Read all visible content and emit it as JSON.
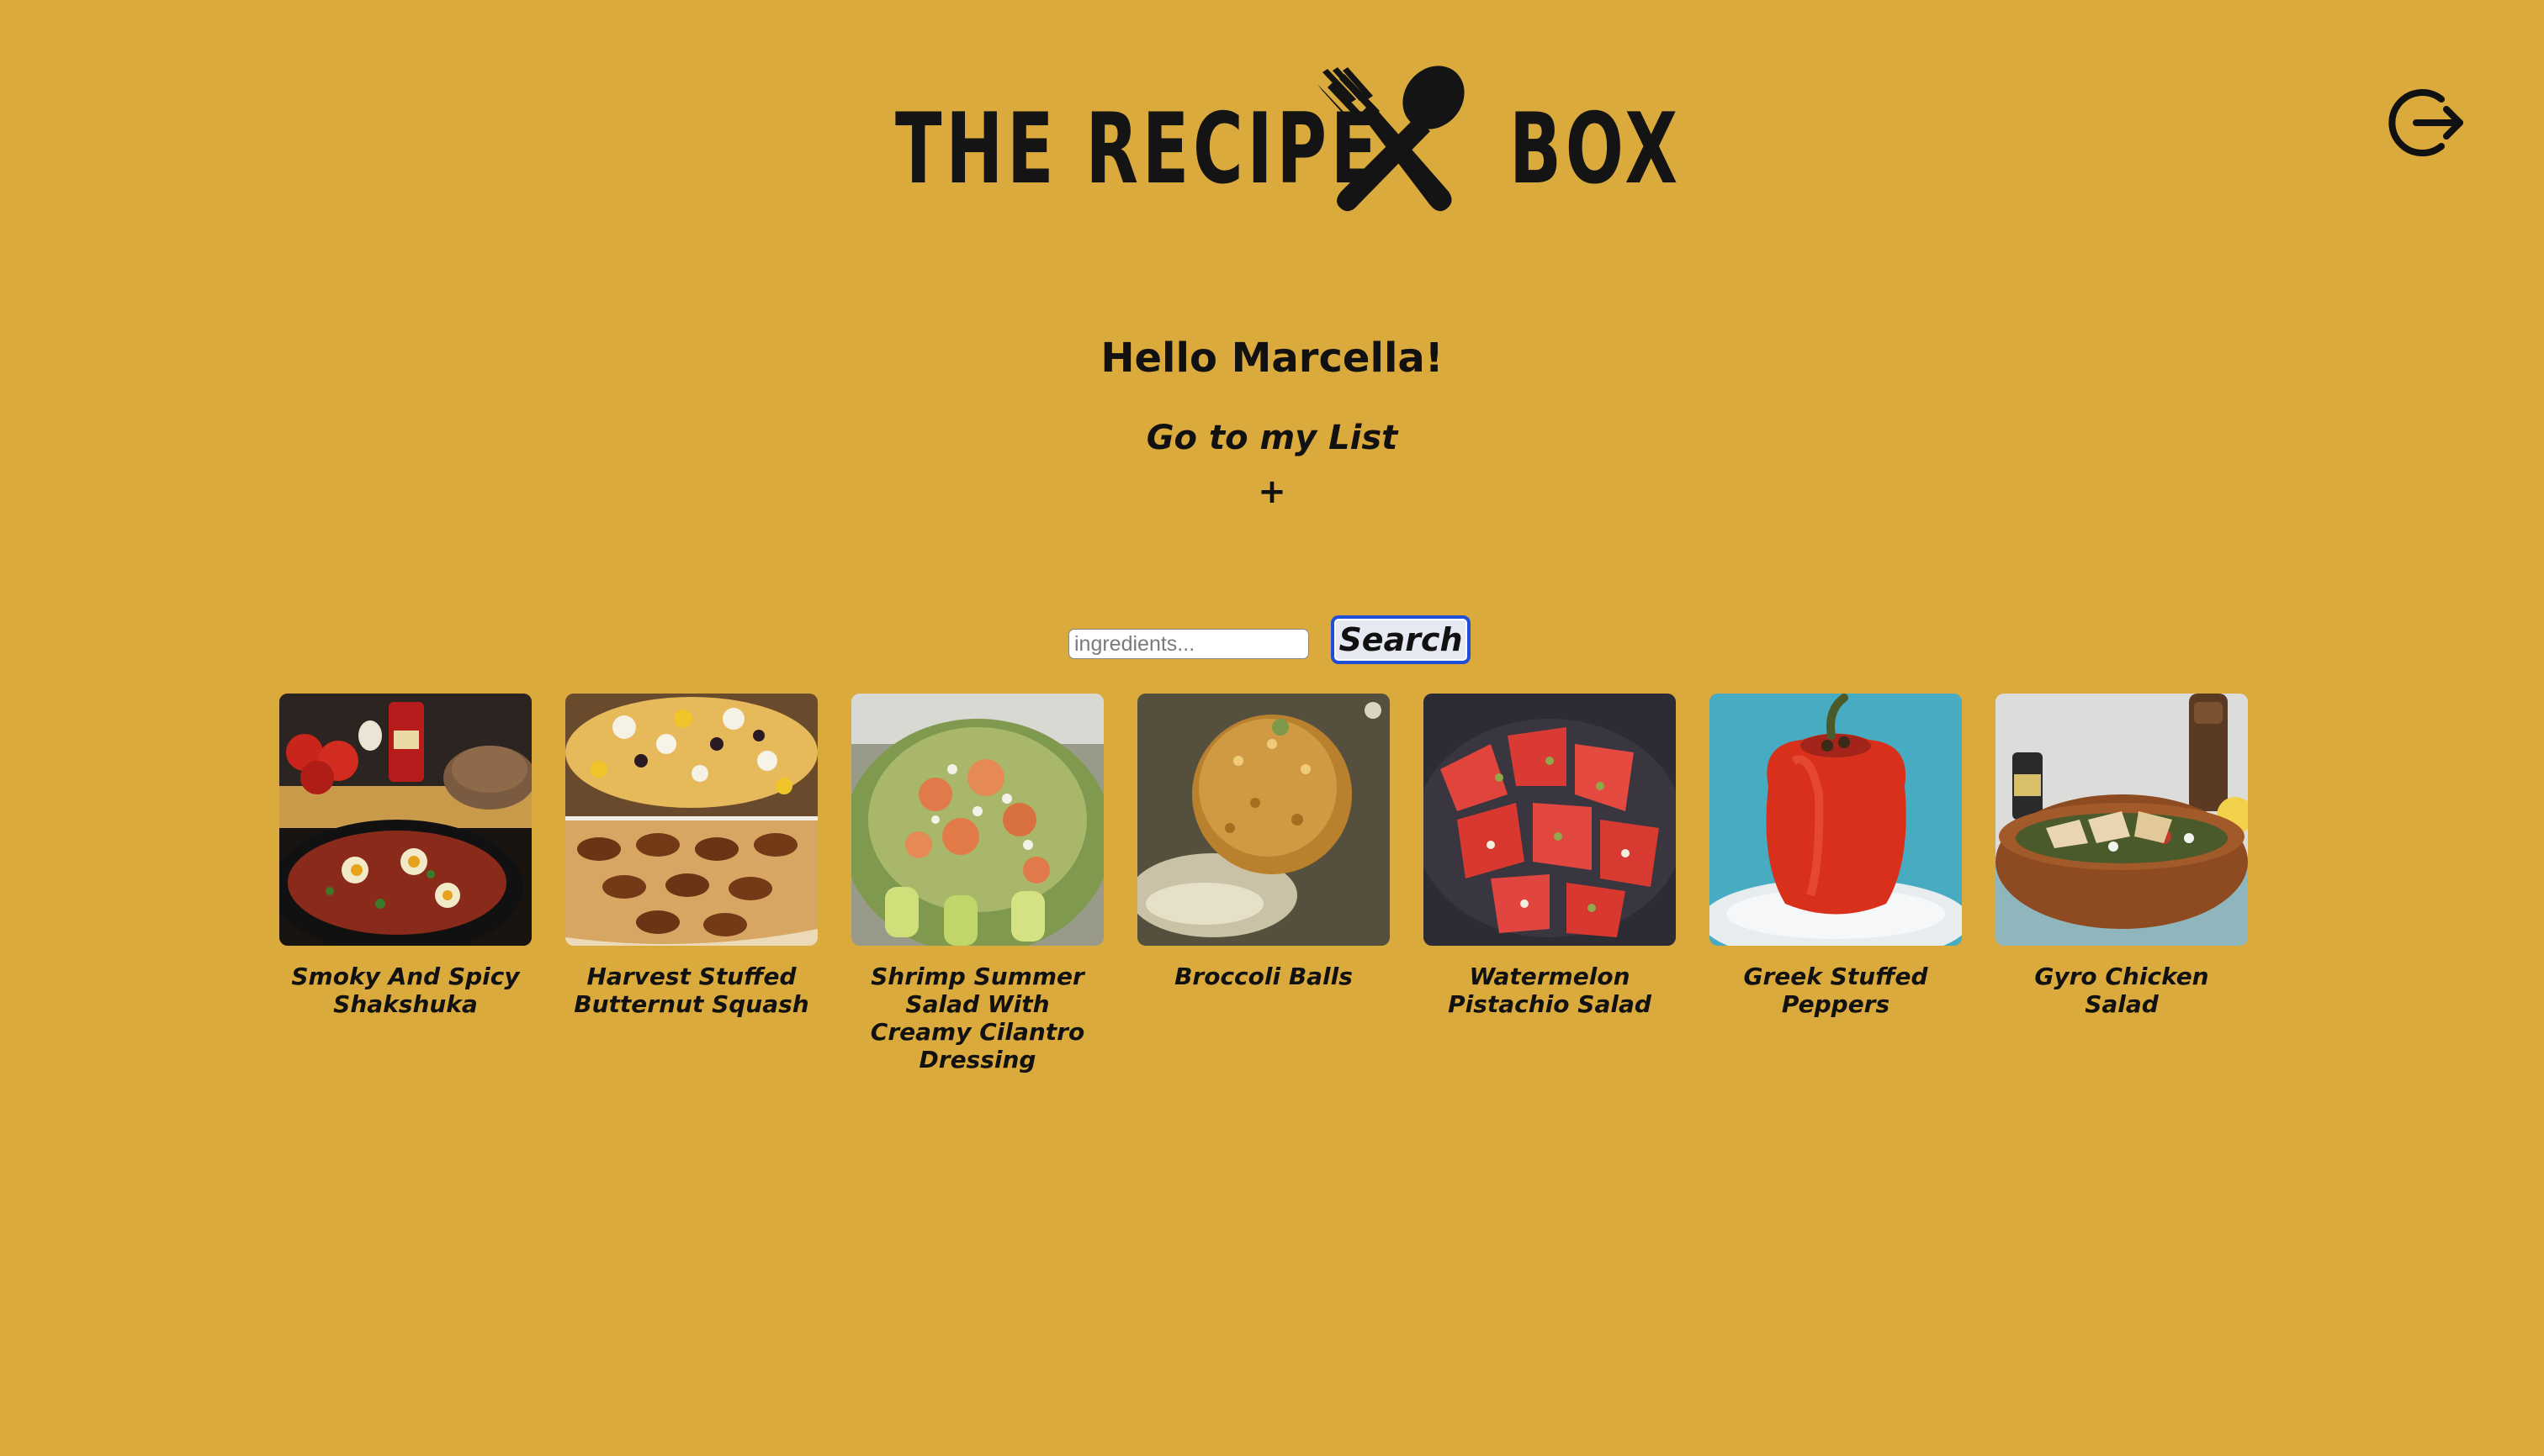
{
  "header": {
    "logo_left_text": "THE RECIPE",
    "logo_right_text": "BOX",
    "logo_icon": "fork-and-spoon-icon",
    "logout_icon": "logout-icon"
  },
  "greeting": "Hello Marcella!",
  "my_list_link": "Go to my List",
  "add_link": "+",
  "search": {
    "placeholder": "ingredients...",
    "value": "",
    "button_label": "Search"
  },
  "recipes": [
    {
      "title": "Smoky And Spicy Shakshuka"
    },
    {
      "title": "Harvest Stuffed Butternut Squash"
    },
    {
      "title": "Shrimp Summer Salad With Creamy Cilantro Dressing"
    },
    {
      "title": "Broccoli Balls"
    },
    {
      "title": "Watermelon Pistachio Salad"
    },
    {
      "title": "Greek Stuffed Peppers"
    },
    {
      "title": "Gyro Chicken Salad"
    }
  ],
  "colors": {
    "background": "#dbaa3c",
    "text": "#111111",
    "search_button_border": "#1e4fd6"
  }
}
